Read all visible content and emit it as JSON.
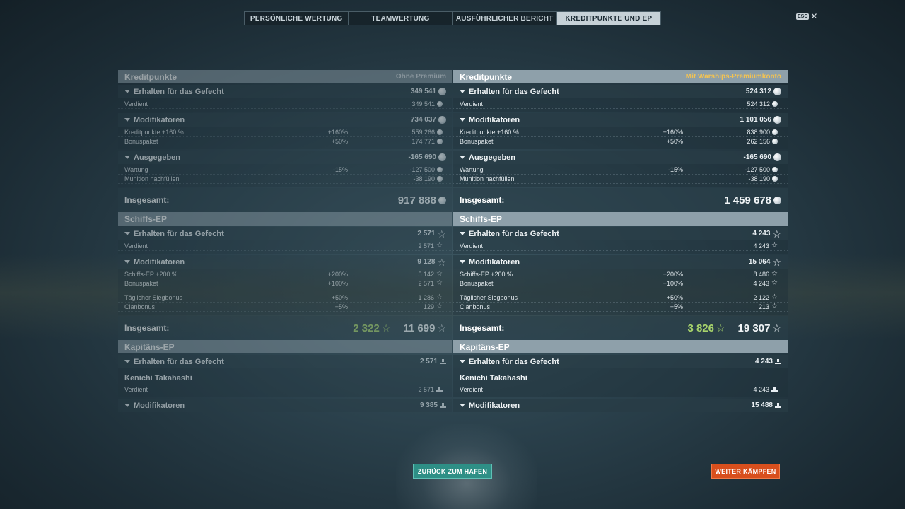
{
  "tabs": [
    {
      "label": "PERSÖNLICHE WERTUNG",
      "active": false
    },
    {
      "label": "TEAMWERTUNG",
      "active": false
    },
    {
      "label": "AUSFÜHRLICHER BERICHT",
      "active": false
    },
    {
      "label": "KREDITPUNKTE UND EP",
      "active": true
    }
  ],
  "esc": {
    "key": "ESC",
    "close": "✕"
  },
  "columns": {
    "left": {
      "credits": {
        "title": "Kreditpunkte",
        "note": "Ohne Premium",
        "earned": {
          "label": "Erhalten für das Gefecht",
          "value": "349 541",
          "rows": [
            {
              "label": "Verdient",
              "pct": "",
              "value": "349 541"
            }
          ]
        },
        "modifiers": {
          "label": "Modifikatoren",
          "value": "734 037",
          "rows": [
            {
              "label": "Kreditpunkte +160 %",
              "pct": "+160%",
              "value": "559 266"
            },
            {
              "label": "Bonuspaket",
              "pct": "+50%",
              "value": "174 771"
            }
          ]
        },
        "spent": {
          "label": "Ausgegeben",
          "value": "-165 690",
          "rows": [
            {
              "label": "Wartung",
              "pct": "-15%",
              "value": "-127 500"
            },
            {
              "label": "Munition nachfüllen",
              "pct": "",
              "value": "-38 190"
            }
          ]
        },
        "total": {
          "label": "Insgesamt:",
          "value": "917 888"
        }
      },
      "ship_xp": {
        "title": "Schiffs-EP",
        "earned": {
          "label": "Erhalten für das Gefecht",
          "value": "2 571",
          "rows": [
            {
              "label": "Verdient",
              "pct": "",
              "value": "2 571"
            }
          ]
        },
        "modifiers": {
          "label": "Modifikatoren",
          "value": "9 128",
          "rows": [
            {
              "label": "Schiffs-EP +200 %",
              "pct": "+200%",
              "value": "5 142"
            },
            {
              "label": "Bonuspaket",
              "pct": "+100%",
              "value": "2 571"
            },
            {
              "label": "Täglicher Siegbonus",
              "pct": "+50%",
              "value": "1 286"
            },
            {
              "label": "Clanbonus",
              "pct": "+5%",
              "value": "129"
            }
          ]
        },
        "total": {
          "label": "Insgesamt:",
          "free": "2 322",
          "value": "11 699"
        }
      },
      "captain_xp": {
        "title": "Kapitäns-EP",
        "earned": {
          "label": "Erhalten für das Gefecht",
          "value": "2 571"
        },
        "captain": "Kenichi Takahashi",
        "rows": [
          {
            "label": "Verdient",
            "pct": "",
            "value": "2 571"
          }
        ],
        "modifiers": {
          "label": "Modifikatoren",
          "value": "9 385"
        }
      }
    },
    "right": {
      "credits": {
        "title": "Kreditpunkte",
        "note": "Mit Warships-Premiumkonto",
        "earned": {
          "label": "Erhalten für das Gefecht",
          "value": "524 312",
          "rows": [
            {
              "label": "Verdient",
              "pct": "",
              "value": "524 312"
            }
          ]
        },
        "modifiers": {
          "label": "Modifikatoren",
          "value": "1 101 056",
          "rows": [
            {
              "label": "Kreditpunkte +160 %",
              "pct": "+160%",
              "value": "838 900"
            },
            {
              "label": "Bonuspaket",
              "pct": "+50%",
              "value": "262 156"
            }
          ]
        },
        "spent": {
          "label": "Ausgegeben",
          "value": "-165 690",
          "rows": [
            {
              "label": "Wartung",
              "pct": "-15%",
              "value": "-127 500"
            },
            {
              "label": "Munition nachfüllen",
              "pct": "",
              "value": "-38 190"
            }
          ]
        },
        "total": {
          "label": "Insgesamt:",
          "value": "1 459 678"
        }
      },
      "ship_xp": {
        "title": "Schiffs-EP",
        "earned": {
          "label": "Erhalten für das Gefecht",
          "value": "4 243",
          "rows": [
            {
              "label": "Verdient",
              "pct": "",
              "value": "4 243"
            }
          ]
        },
        "modifiers": {
          "label": "Modifikatoren",
          "value": "15 064",
          "rows": [
            {
              "label": "Schiffs-EP +200 %",
              "pct": "+200%",
              "value": "8 486"
            },
            {
              "label": "Bonuspaket",
              "pct": "+100%",
              "value": "4 243"
            },
            {
              "label": "Täglicher Siegbonus",
              "pct": "+50%",
              "value": "2 122"
            },
            {
              "label": "Clanbonus",
              "pct": "+5%",
              "value": "213"
            }
          ]
        },
        "total": {
          "label": "Insgesamt:",
          "free": "3 826",
          "value": "19 307"
        }
      },
      "captain_xp": {
        "title": "Kapitäns-EP",
        "earned": {
          "label": "Erhalten für das Gefecht",
          "value": "4 243"
        },
        "captain": "Kenichi Takahashi",
        "rows": [
          {
            "label": "Verdient",
            "pct": "",
            "value": "4 243"
          }
        ],
        "modifiers": {
          "label": "Modifikatoren",
          "value": "15 488"
        }
      }
    }
  },
  "buttons": {
    "back": "ZURÜCK ZUM HAFEN",
    "fight": "WEITER KÄMPFEN"
  }
}
